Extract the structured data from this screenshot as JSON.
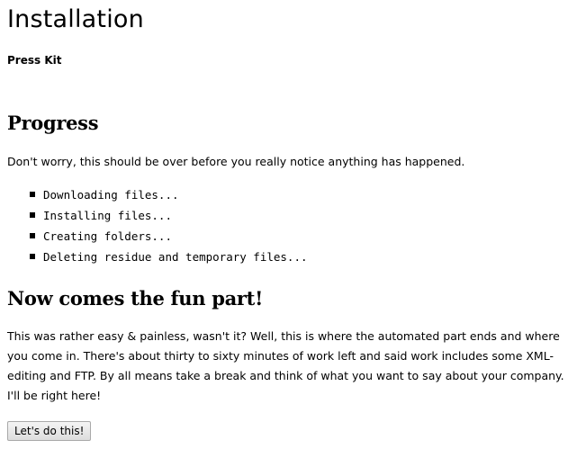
{
  "header": {
    "title": "Installation",
    "subtitle": "Press Kit"
  },
  "progress": {
    "heading": "Progress",
    "intro": "Don't worry, this should be over before you really notice anything has happened.",
    "steps": [
      {
        "label": "Downloading files..."
      },
      {
        "label": "Installing files..."
      },
      {
        "label": "Creating folders..."
      },
      {
        "label": "Deleting residue and temporary files..."
      }
    ]
  },
  "next": {
    "heading": "Now comes the fun part!",
    "body": "This was rather easy & painless, wasn't it? Well, this is where the automated part ends and where you come in. There's about thirty to sixty minutes of work left and said work includes some XML-editing and FTP. By all means take a break and think of what you want to say about your company. I'll be right here!",
    "button_label": "Let's do this!"
  }
}
